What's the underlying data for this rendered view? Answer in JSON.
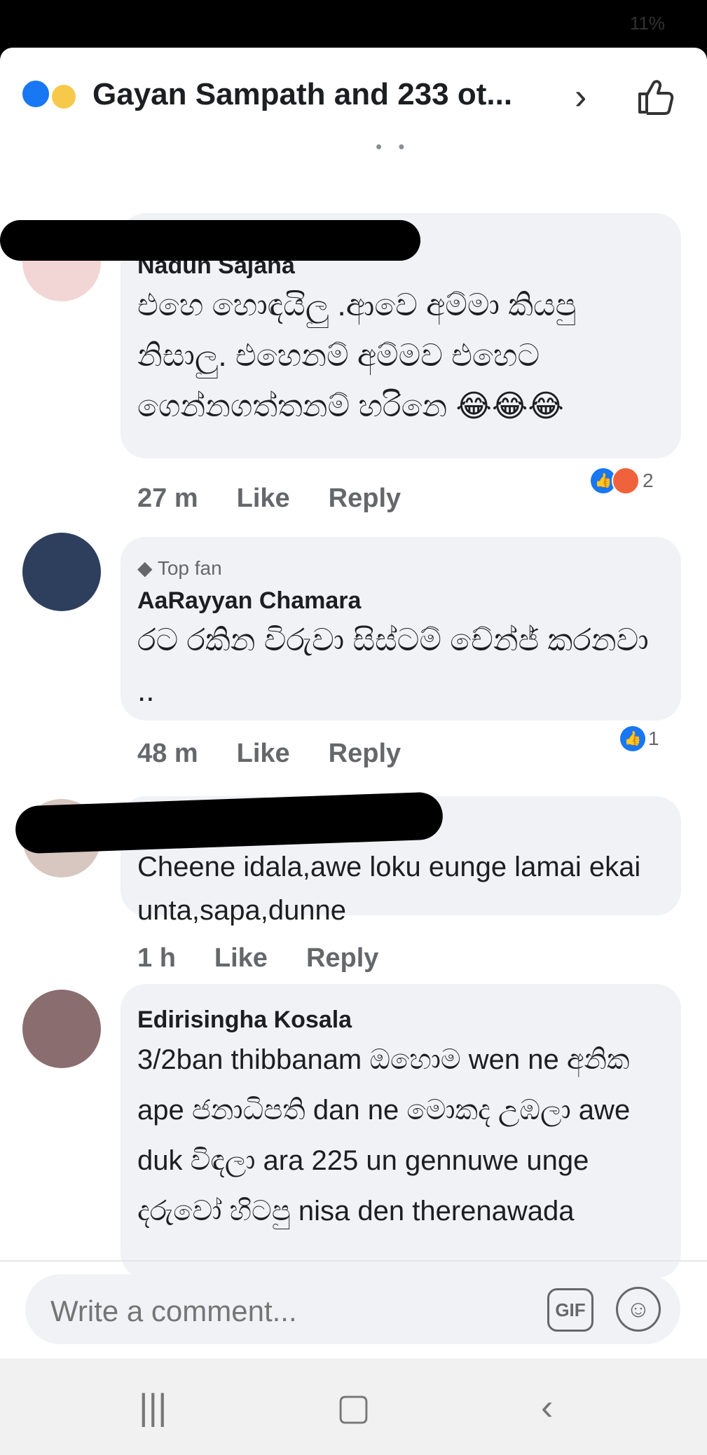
{
  "status_bar": {
    "battery": "11%"
  },
  "header": {
    "title": "Gayan Sampath and 233 ot...",
    "reaction_icons": [
      "like-icon",
      "sad-icon"
    ],
    "chevron": "›",
    "thumbs_icon": "thumbs-up-icon"
  },
  "comments": [
    {
      "author": "Nadun Sajana",
      "text": "එහෙ හොඳයිලු .ආවෙ අම්මා කියපු නිසාලු. එහෙනම් අම්මව එහෙට ගෙන්නගත්තනම් හරිනෙ 😂😂😂",
      "time": "27 m",
      "like": "Like",
      "reply": "Reply",
      "reaction_count": "2",
      "redacted": true
    },
    {
      "badge": "Top fan",
      "author": "AaRayyan Chamara",
      "text": "රට රකින විරුවා සිස්ටම් චේන්ජ් කරනවා ..",
      "time": "48 m",
      "like": "Like",
      "reply": "Reply",
      "reaction_count": "1"
    },
    {
      "text": "Cheene idala,awe loku eunge lamai ekai unta,sapa,dunne",
      "time": "1 h",
      "like": "Like",
      "reply": "Reply",
      "redacted": true
    },
    {
      "author": "Edirisingha Kosala",
      "text": "3/2ban thibbanam ඔහොම wen ne අනික ape ජනාධිපති dan ne මොකද උඹලා awe duk විඳලා ara 225 un gennuwe unge දරුවෝ හිටපු nisa den therenawada"
    }
  ],
  "composer": {
    "placeholder": "Write a comment...",
    "gif": "GIF"
  },
  "navbar": {
    "recent": "|||",
    "home": "▢",
    "back": "‹"
  }
}
